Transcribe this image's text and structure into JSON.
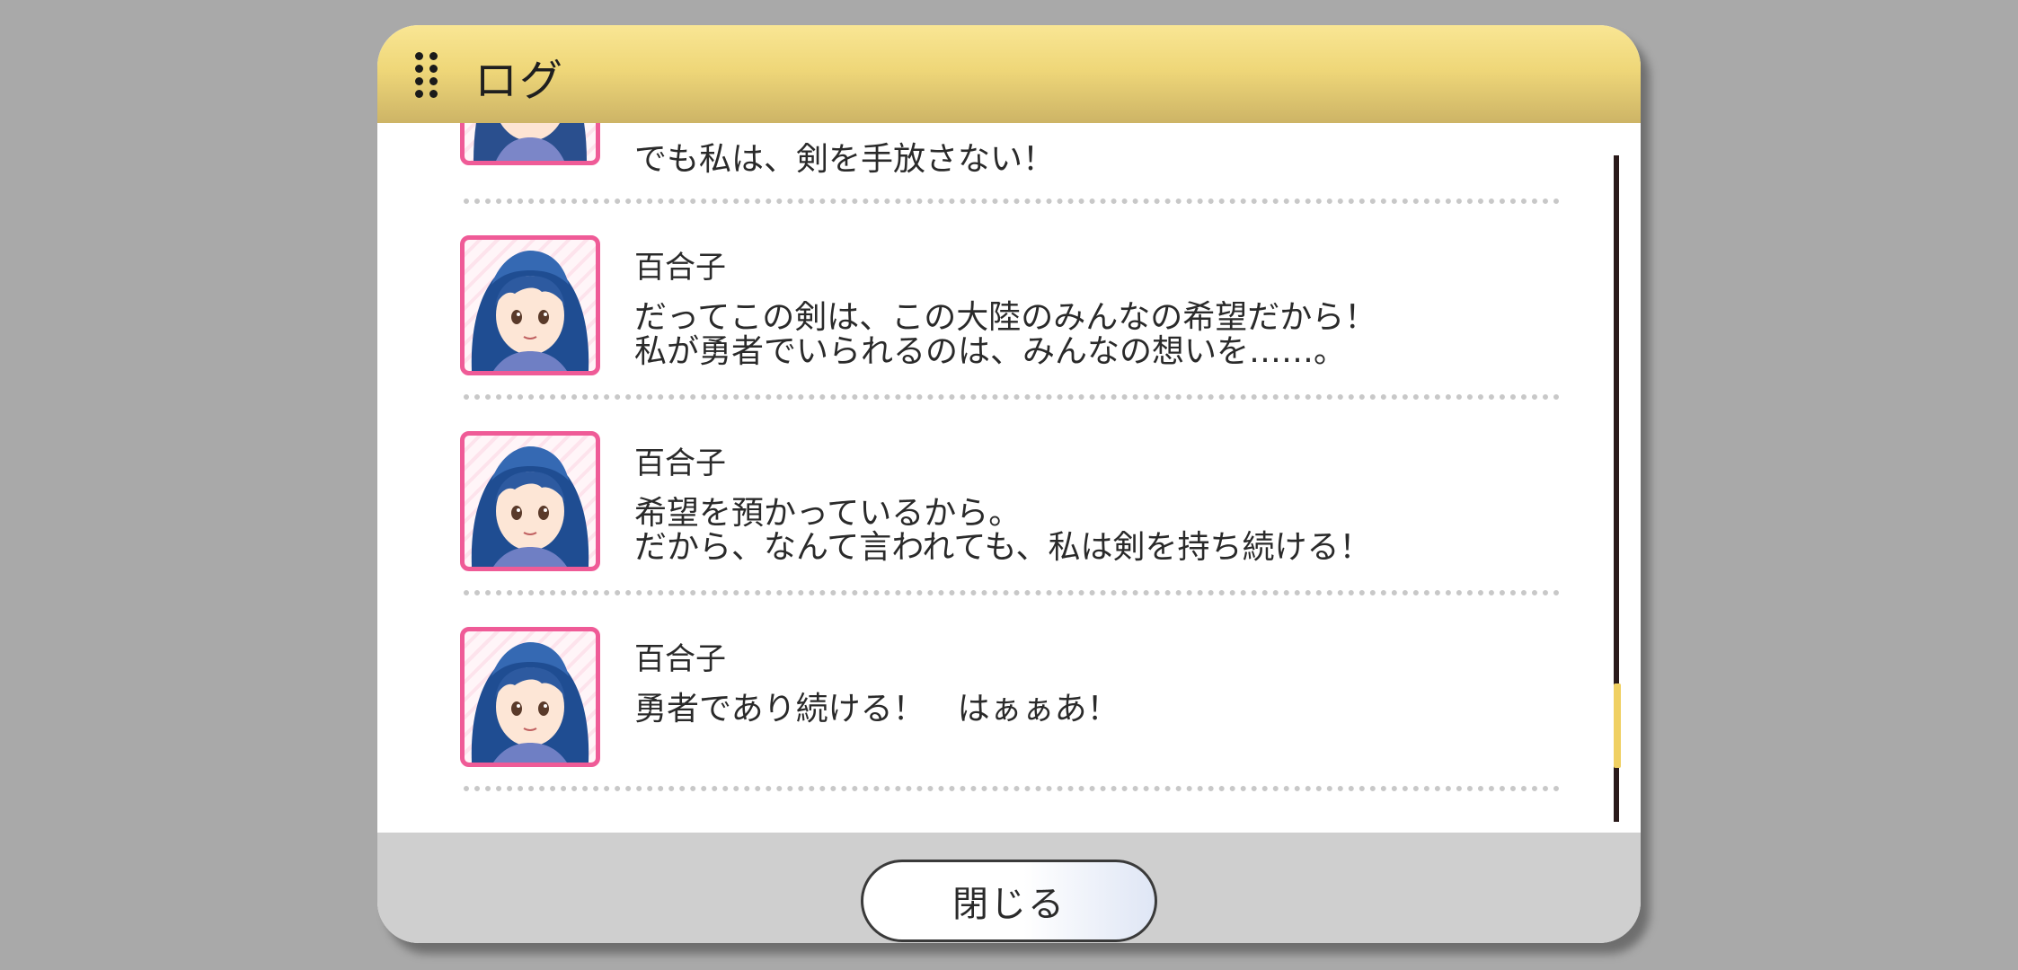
{
  "window": {
    "title": "ログ"
  },
  "log": {
    "entries": [
      {
        "speaker": "",
        "lines": [
          "でも私は、剣を手放さない！"
        ]
      },
      {
        "speaker": "百合子",
        "lines": [
          "だってこの剣は、この大陸のみんなの希望だから！",
          "私が勇者でいられるのは、みんなの想いを……。"
        ]
      },
      {
        "speaker": "百合子",
        "lines": [
          "希望を預かっているから。",
          "だから、なんて言われても、私は剣を持ち続ける！"
        ]
      },
      {
        "speaker": "百合子",
        "lines": [
          "勇者であり続ける！　はぁぁあ！"
        ]
      }
    ]
  },
  "footer": {
    "close_label": "閉じる"
  },
  "colors": {
    "header_gold": "#efd779",
    "portrait_border": "#ef5b97",
    "scroll_thumb": "#f0d062",
    "footer_bg": "#cfcfcf"
  },
  "icons": {
    "grip": "drag-handle-icon",
    "portrait": "character-portrait"
  }
}
